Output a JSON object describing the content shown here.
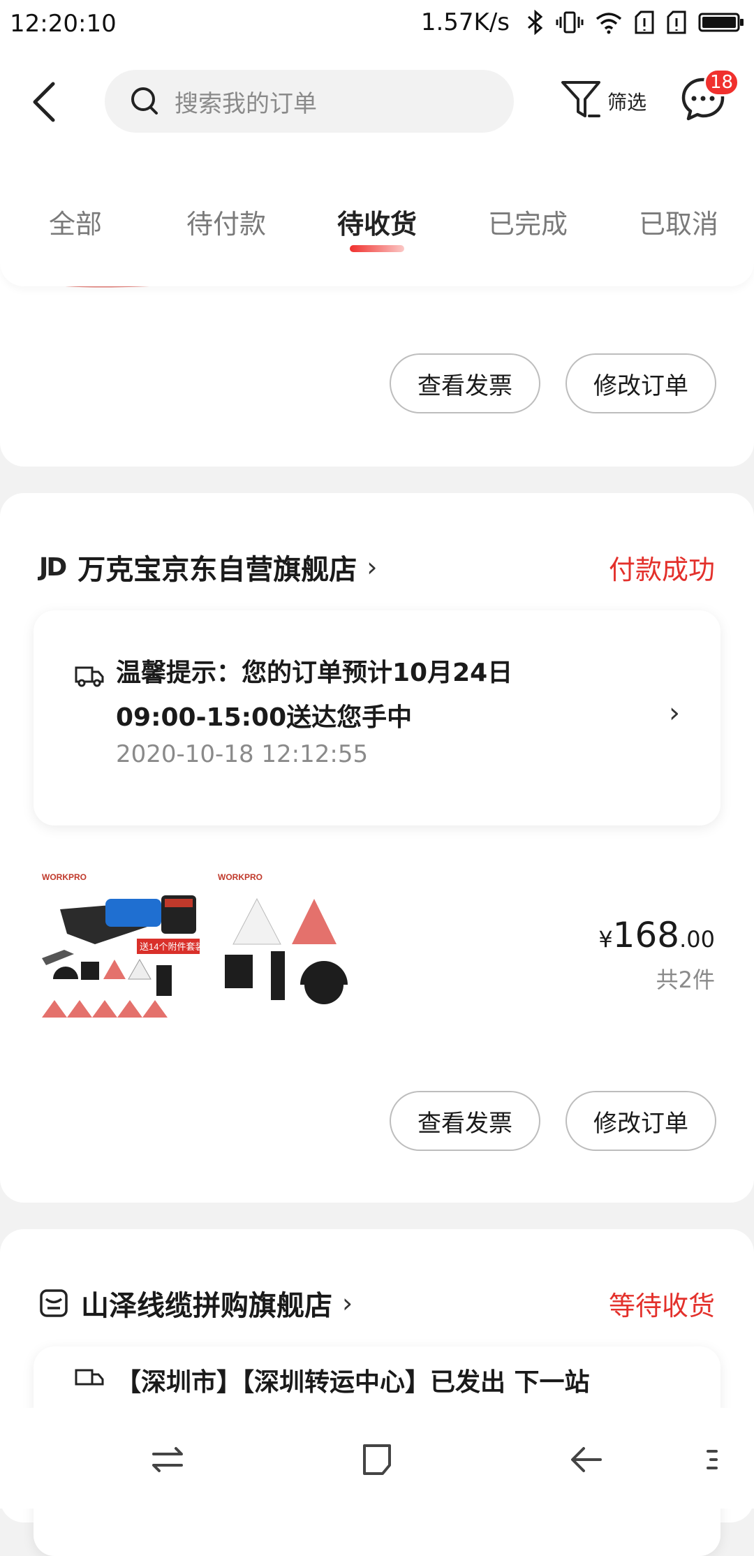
{
  "status_bar": {
    "time": "12:20:10",
    "net_speed": "1.57K/s",
    "icons": [
      "bluetooth-icon",
      "vibrate-icon",
      "wifi-icon",
      "sim1-icon",
      "sim2-icon",
      "battery-icon"
    ]
  },
  "header": {
    "search_placeholder": "搜索我的订单",
    "filter_label": "筛选",
    "message_badge": "18"
  },
  "tabs": [
    {
      "label": "全部",
      "active": false
    },
    {
      "label": "待付款",
      "active": false
    },
    {
      "label": "待收货",
      "active": true
    },
    {
      "label": "已完成",
      "active": false
    },
    {
      "label": "已取消",
      "active": false
    }
  ],
  "orders": [
    {
      "buttons": [
        "查看发票",
        "修改订单"
      ]
    },
    {
      "shop_logo": "JD",
      "shop_name": "万克宝京东自营旗舰店",
      "status": "付款成功",
      "tip": "温馨提示：您的订单预计10月24日09:00-15:00送达您手中",
      "tip_time": "2020-10-18 12:12:55",
      "product_brand": "WORKPRO",
      "product_badge": "送14个附件套装",
      "price_symbol": "¥",
      "price_int": "168",
      "price_dec": ".00",
      "item_count": "共2件",
      "buttons": [
        "查看发票",
        "修改订单"
      ]
    },
    {
      "shop_name": "山泽线缆拼购旗舰店",
      "status": "等待收货",
      "tip": "【深圳市】【深圳转运中心】已发出 下一站"
    }
  ],
  "colors": {
    "accent": "#e3302b",
    "badge": "#f0302d",
    "page_bg": "#f2f2f2"
  }
}
